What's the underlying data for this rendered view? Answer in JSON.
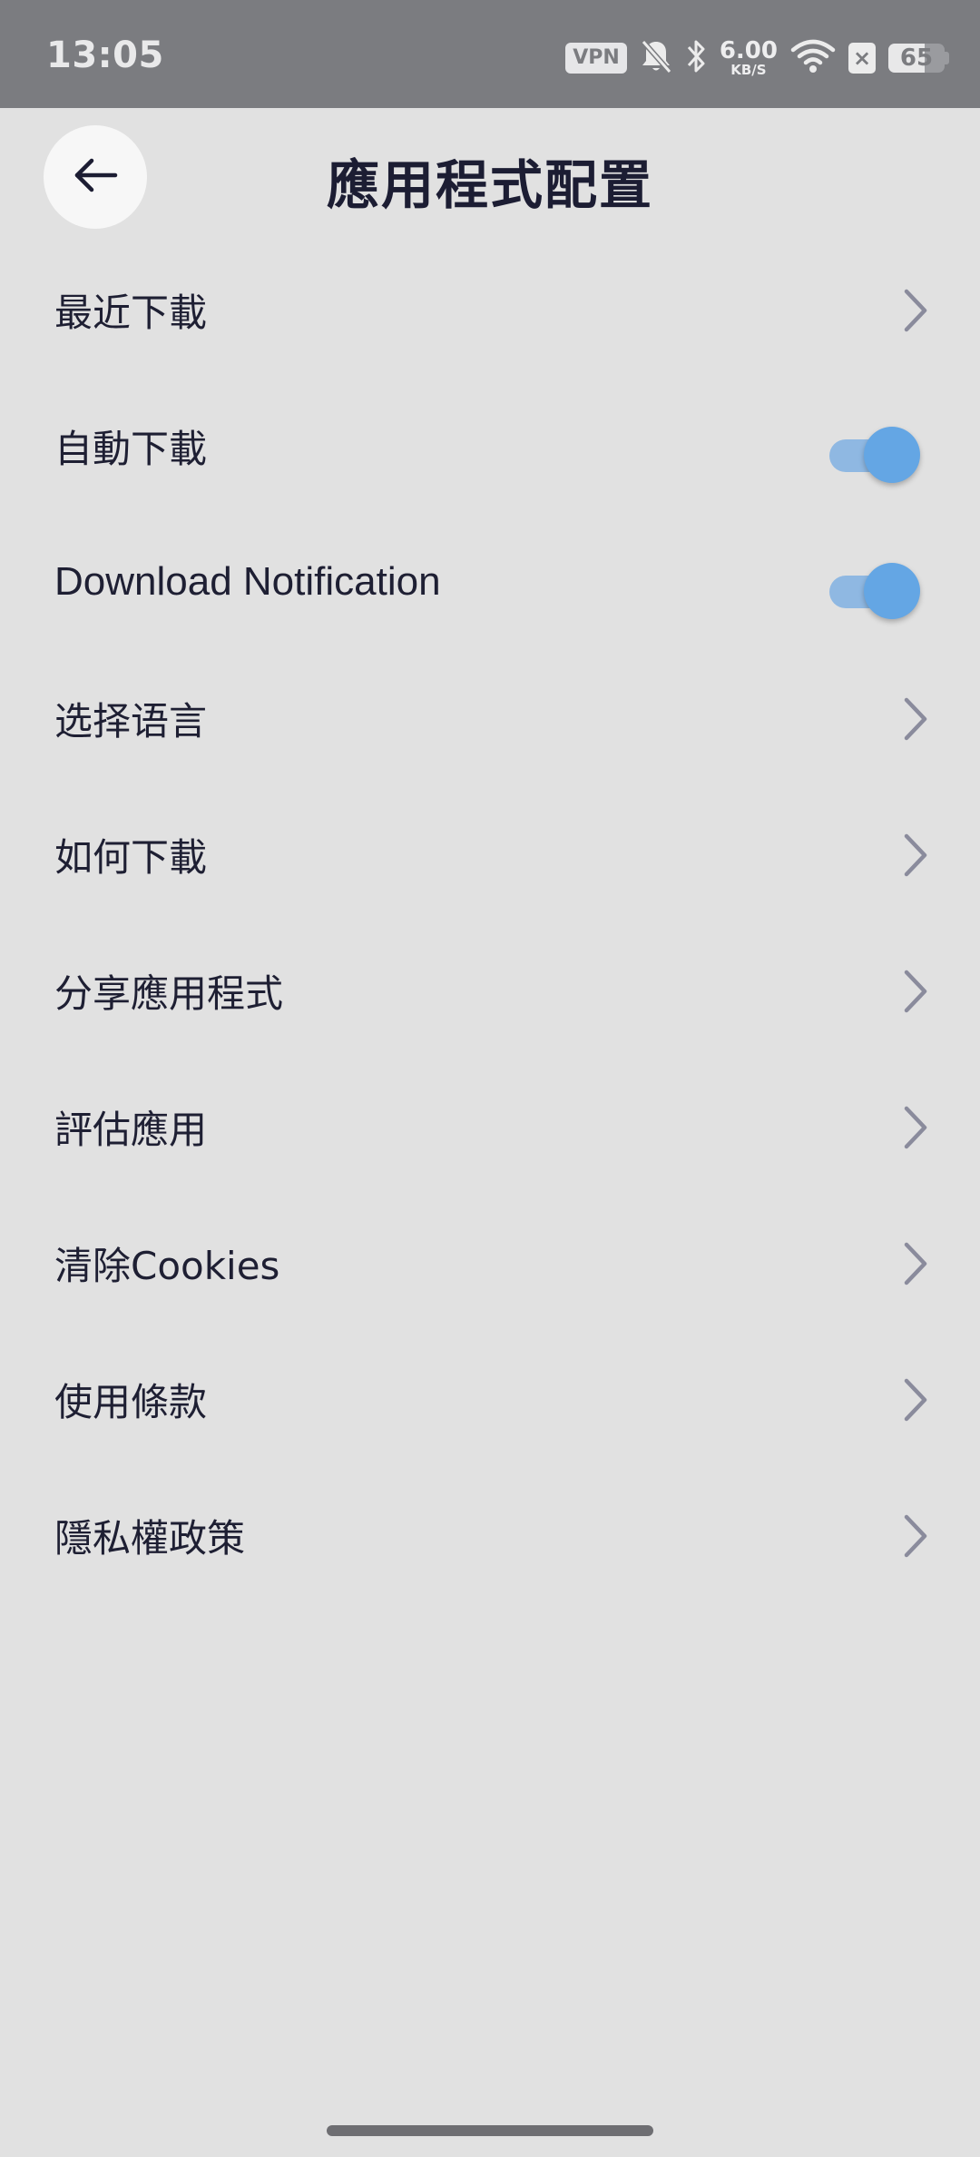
{
  "status_bar": {
    "time": "13:05",
    "vpn": "VPN",
    "net_speed_value": "6.00",
    "net_speed_unit": "KB/S",
    "battery": "65",
    "battery_level": 0.65,
    "icons": [
      "vpn-badge",
      "bell-off-icon",
      "bluetooth-icon",
      "net-speed",
      "wifi-icon",
      "no-sim-icon",
      "battery-icon"
    ]
  },
  "header": {
    "back_icon": "arrow-left-icon",
    "title": "應用程式配置"
  },
  "settings": {
    "items": [
      {
        "label": "最近下載",
        "control": "chevron"
      },
      {
        "label": "自動下載",
        "control": "toggle",
        "on": true
      },
      {
        "label": "Download Notification",
        "control": "toggle",
        "on": true
      },
      {
        "label": "选择语言",
        "control": "chevron"
      },
      {
        "label": "如何下載",
        "control": "chevron"
      },
      {
        "label": "分享應用程式",
        "control": "chevron"
      },
      {
        "label": "評估應用",
        "control": "chevron"
      },
      {
        "label": "清除Cookies",
        "control": "chevron"
      },
      {
        "label": "使用條款",
        "control": "chevron"
      },
      {
        "label": "隱私權政策",
        "control": "chevron"
      }
    ]
  },
  "colors": {
    "background": "#e1e1e1",
    "status_bar": "#7b7c80",
    "text": "#1e1f33",
    "chevron": "#8a8b9c",
    "toggle_track": "#8fb8e2",
    "toggle_thumb": "#64a6e4"
  }
}
